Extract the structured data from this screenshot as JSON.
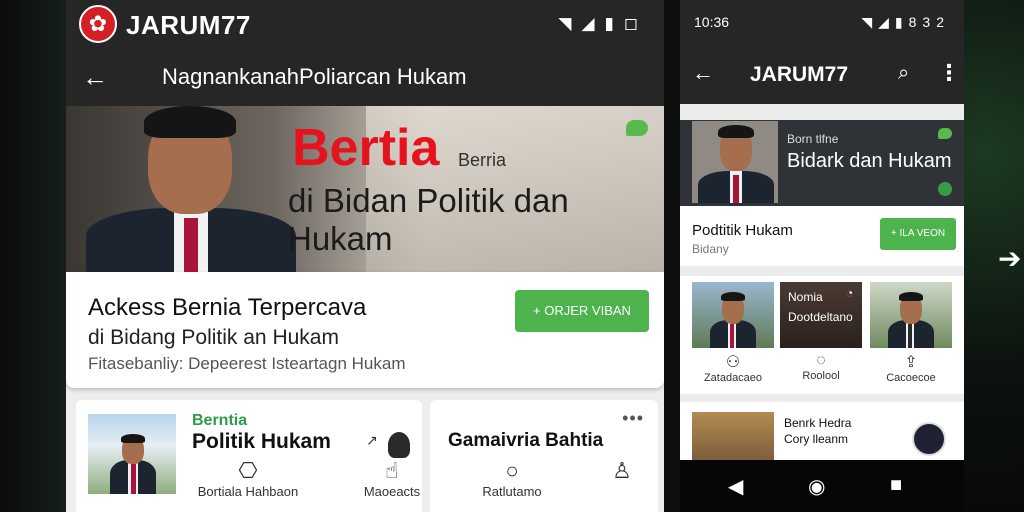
{
  "phone1": {
    "status": {
      "brand": "JARUM77",
      "icons": [
        "wifi-icon",
        "signal-icon",
        "battery-icon",
        "square-icon"
      ]
    },
    "appbar": {
      "title": "NagnankanahPoliarcan Hukam"
    },
    "hero": {
      "headline": "Bertia",
      "small": "Berria",
      "subheadline": "di Bidan Politik dan Hukam"
    },
    "card": {
      "line1": "Ackess Bernia Terpercava",
      "line2": "di Bidang Politik an Hukam",
      "line3": "Fitasebanliy: Depeerest Isteartagn Hukam",
      "button": "+ ORJER VIBAN"
    },
    "news": [
      {
        "category": "Berntia",
        "title": "Politik Hukam"
      },
      {
        "title": "Gamaivria Bahtia"
      }
    ],
    "bottom_nav": [
      {
        "label": "Bortiala Hahbaon",
        "icon": "book-icon"
      },
      {
        "label": "Maoeacts",
        "icon": "touch-icon"
      },
      {
        "label": "Ratlutamo",
        "icon": "circle-icon"
      },
      {
        "label": "",
        "icon": "profile-icon"
      }
    ]
  },
  "phone2": {
    "status": {
      "time": "10:36",
      "battery": "832"
    },
    "appbar": {
      "title": "JARUM77"
    },
    "hero": {
      "small": "Born tlfne",
      "big": "Bidark dan Hukam"
    },
    "section": {
      "title": "Podtitik Hukam",
      "subtitle": "Bidany",
      "button": "+ ILA VEON"
    },
    "grid": [
      {
        "label": "Zatadacaeo"
      },
      {
        "label": "Roolool",
        "overlay1": "Nomia",
        "overlay2": "Dootdeltano"
      },
      {
        "label": "Cacoecoe"
      }
    ],
    "list_item": {
      "line1": "Benrk Hedra",
      "line2": "Cory lleanm"
    }
  }
}
